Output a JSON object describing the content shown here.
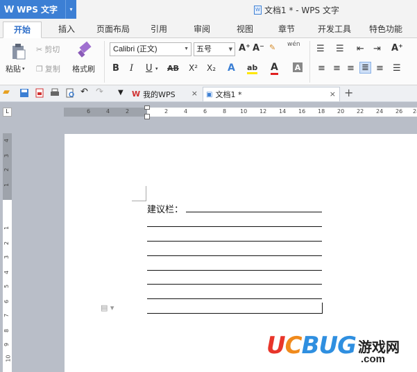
{
  "app": {
    "name": "WPS 文字",
    "logo": "W",
    "menu_arrow": "▾"
  },
  "window": {
    "title": "文档1 * - WPS 文字"
  },
  "tabs": [
    {
      "label": "开始",
      "active": true
    },
    {
      "label": "插入"
    },
    {
      "label": "页面布局"
    },
    {
      "label": "引用"
    },
    {
      "label": "审阅"
    },
    {
      "label": "视图"
    },
    {
      "label": "章节"
    },
    {
      "label": "开发工具"
    },
    {
      "label": "特色功能"
    }
  ],
  "ribbon": {
    "paste_label": "粘贴",
    "cut_label": "剪切",
    "copy_label": "复制",
    "format_painter_label": "格式刷",
    "font_name": "Calibri (正文)",
    "font_size": "五号",
    "bold": "B",
    "italic": "I",
    "underline": "U",
    "strike": "AB",
    "superscript": "X²",
    "subscript": "X₂",
    "grow_font": "A⁺",
    "shrink_font": "A⁻",
    "pinyin": "wén",
    "text_effect": "A",
    "highlight": "ab",
    "font_color": "A",
    "char_shade": "A"
  },
  "doc_tabs": [
    {
      "label": "我的WPS",
      "close": "×"
    },
    {
      "label": "文档1 *",
      "close": "×",
      "active": true
    }
  ],
  "new_tab": "+",
  "hruler_numbers": [
    "6",
    "4",
    "2",
    "2",
    "4",
    "6",
    "8",
    "10",
    "12",
    "14",
    "16",
    "18",
    "20",
    "22",
    "24",
    "26",
    "28"
  ],
  "vruler_numbers": [
    "4",
    "3",
    "2",
    "1",
    "1",
    "2",
    "3",
    "4",
    "5",
    "6",
    "7",
    "8",
    "9",
    "10",
    "11"
  ],
  "document": {
    "suggestion_label": "建议栏："
  },
  "watermark": {
    "brand": "UCBUG",
    "cn": "游戏网",
    "domain": ".com"
  },
  "colors": {
    "accent": "#3c7fd4",
    "highlight": "#ffe600",
    "font_color": "#e02020"
  }
}
